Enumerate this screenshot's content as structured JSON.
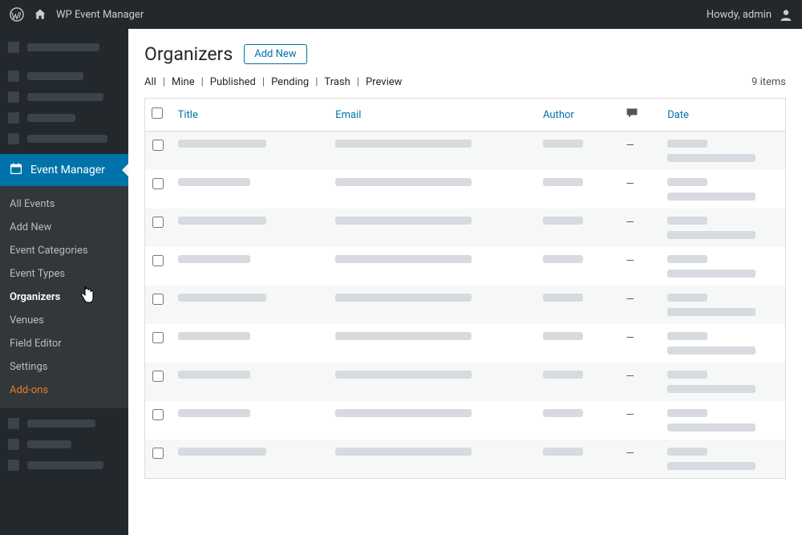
{
  "topbar": {
    "site_title": "WP Event Manager",
    "greeting": "Howdy, admin"
  },
  "sidebar": {
    "active_label": "Event Manager",
    "submenu": [
      {
        "label": "All Events",
        "current": false,
        "addon": false
      },
      {
        "label": "Add New",
        "current": false,
        "addon": false
      },
      {
        "label": "Event Categories",
        "current": false,
        "addon": false
      },
      {
        "label": "Event Types",
        "current": false,
        "addon": false
      },
      {
        "label": "Organizers",
        "current": true,
        "addon": false
      },
      {
        "label": "Venues",
        "current": false,
        "addon": false
      },
      {
        "label": "Field Editor",
        "current": false,
        "addon": false
      },
      {
        "label": "Settings",
        "current": false,
        "addon": false
      },
      {
        "label": "Add-ons",
        "current": false,
        "addon": true
      }
    ]
  },
  "page": {
    "title": "Organizers",
    "add_new_label": "Add New",
    "item_count": "9 items"
  },
  "filters": [
    "All",
    "Mine",
    "Published",
    "Pending",
    "Trash",
    "Preview"
  ],
  "table": {
    "columns": {
      "title": "Title",
      "email": "Email",
      "author": "Author",
      "date": "Date"
    },
    "rows": 9
  }
}
